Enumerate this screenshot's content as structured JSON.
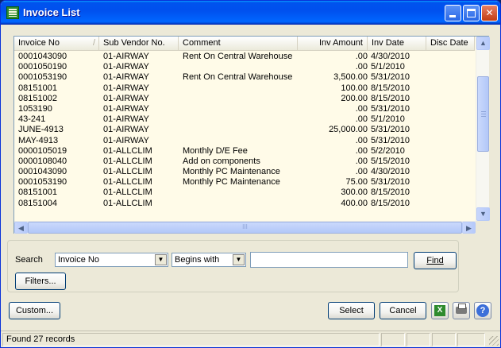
{
  "window": {
    "title": "Invoice List"
  },
  "grid": {
    "columns": [
      "Invoice No",
      "Sub Vendor No.",
      "Comment",
      "Inv Amount",
      "Inv Date",
      "Disc Date"
    ],
    "rows": [
      {
        "invoice_no": "0001043090",
        "vendor": "01-AIRWAY",
        "comment": "Rent On Central Warehouse",
        "amount": ".00",
        "inv_date": "4/30/2010",
        "disc_date": ""
      },
      {
        "invoice_no": "0001050190",
        "vendor": "01-AIRWAY",
        "comment": "",
        "amount": ".00",
        "inv_date": "5/1/2010",
        "disc_date": ""
      },
      {
        "invoice_no": "0001053190",
        "vendor": "01-AIRWAY",
        "comment": "Rent On Central Warehouse",
        "amount": "3,500.00",
        "inv_date": "5/31/2010",
        "disc_date": ""
      },
      {
        "invoice_no": "08151001",
        "vendor": "01-AIRWAY",
        "comment": "",
        "amount": "100.00",
        "inv_date": "8/15/2010",
        "disc_date": ""
      },
      {
        "invoice_no": "08151002",
        "vendor": "01-AIRWAY",
        "comment": "",
        "amount": "200.00",
        "inv_date": "8/15/2010",
        "disc_date": ""
      },
      {
        "invoice_no": "1053190",
        "vendor": "01-AIRWAY",
        "comment": "",
        "amount": ".00",
        "inv_date": "5/31/2010",
        "disc_date": ""
      },
      {
        "invoice_no": "43-241",
        "vendor": "01-AIRWAY",
        "comment": "",
        "amount": ".00",
        "inv_date": "5/1/2010",
        "disc_date": ""
      },
      {
        "invoice_no": "JUNE-4913",
        "vendor": "01-AIRWAY",
        "comment": "",
        "amount": "25,000.00",
        "inv_date": "5/31/2010",
        "disc_date": ""
      },
      {
        "invoice_no": "MAY-4913",
        "vendor": "01-AIRWAY",
        "comment": "",
        "amount": ".00",
        "inv_date": "5/31/2010",
        "disc_date": ""
      },
      {
        "invoice_no": "0000105019",
        "vendor": "01-ALLCLIM",
        "comment": "Monthly D/E Fee",
        "amount": ".00",
        "inv_date": "5/2/2010",
        "disc_date": ""
      },
      {
        "invoice_no": "0000108040",
        "vendor": "01-ALLCLIM",
        "comment": "Add on components",
        "amount": ".00",
        "inv_date": "5/15/2010",
        "disc_date": ""
      },
      {
        "invoice_no": "0001043090",
        "vendor": "01-ALLCLIM",
        "comment": "Monthly PC Maintenance",
        "amount": ".00",
        "inv_date": "4/30/2010",
        "disc_date": ""
      },
      {
        "invoice_no": "0001053190",
        "vendor": "01-ALLCLIM",
        "comment": "Monthly PC Maintenance",
        "amount": "75.00",
        "inv_date": "5/31/2010",
        "disc_date": ""
      },
      {
        "invoice_no": "08151001",
        "vendor": "01-ALLCLIM",
        "comment": "",
        "amount": "300.00",
        "inv_date": "8/15/2010",
        "disc_date": ""
      },
      {
        "invoice_no": "08151004",
        "vendor": "01-ALLCLIM",
        "comment": "",
        "amount": "400.00",
        "inv_date": "8/15/2010",
        "disc_date": ""
      }
    ],
    "scroll_mid_glyph": "III"
  },
  "search": {
    "label": "Search",
    "field_value": "Invoice No",
    "operator_value": "Begins with",
    "text_value": "",
    "find_label": "Find",
    "filters_label": "Filters..."
  },
  "buttons": {
    "custom_label": "Custom...",
    "select_label": "Select",
    "cancel_label": "Cancel"
  },
  "status": {
    "text": "Found 27 records"
  },
  "colors": {
    "grid_background": "#fffbe8",
    "title_bar": "#0053ee",
    "window_face": "#ece9d8"
  }
}
